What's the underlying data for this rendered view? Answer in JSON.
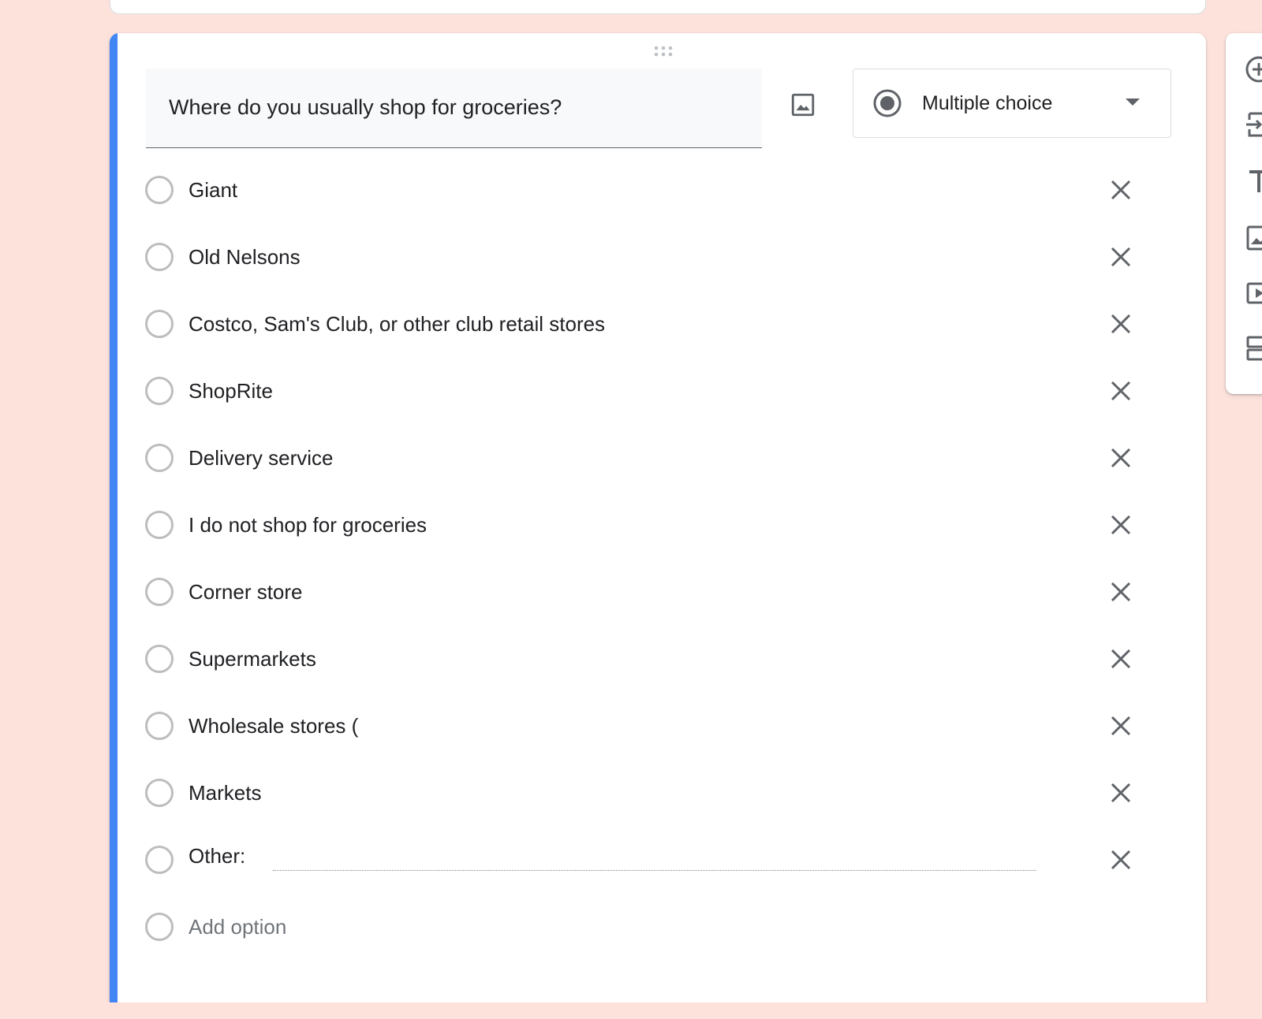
{
  "question": {
    "title": "Where do you usually shop for groceries?",
    "type_label": "Multiple choice"
  },
  "options": [
    {
      "label": "Giant"
    },
    {
      "label": "Old Nelsons"
    },
    {
      "label": "Costco, Sam's Club, or other club retail stores"
    },
    {
      "label": "ShopRite"
    },
    {
      "label": "Delivery service"
    },
    {
      "label": "I do not shop for groceries"
    },
    {
      "label": "Corner store"
    },
    {
      "label": "Supermarkets"
    },
    {
      "label": "Wholesale stores ("
    },
    {
      "label": "Markets"
    }
  ],
  "other_label": "Other:",
  "add_option_label": "Add option",
  "colors": {
    "accent": "#4285f4",
    "background": "#fde2dc",
    "radio_border": "#bdbdbd",
    "icon_gray": "#5f6368"
  },
  "icons": {
    "image": "image-icon",
    "type_radio": "radio-checked-icon",
    "caret": "caret-down-icon",
    "remove": "close-icon",
    "drag": "drag-handle-icon",
    "toolbar": [
      "add-question-icon",
      "import-questions-icon",
      "add-title-icon",
      "add-image-icon",
      "add-video-icon",
      "add-section-icon"
    ]
  }
}
